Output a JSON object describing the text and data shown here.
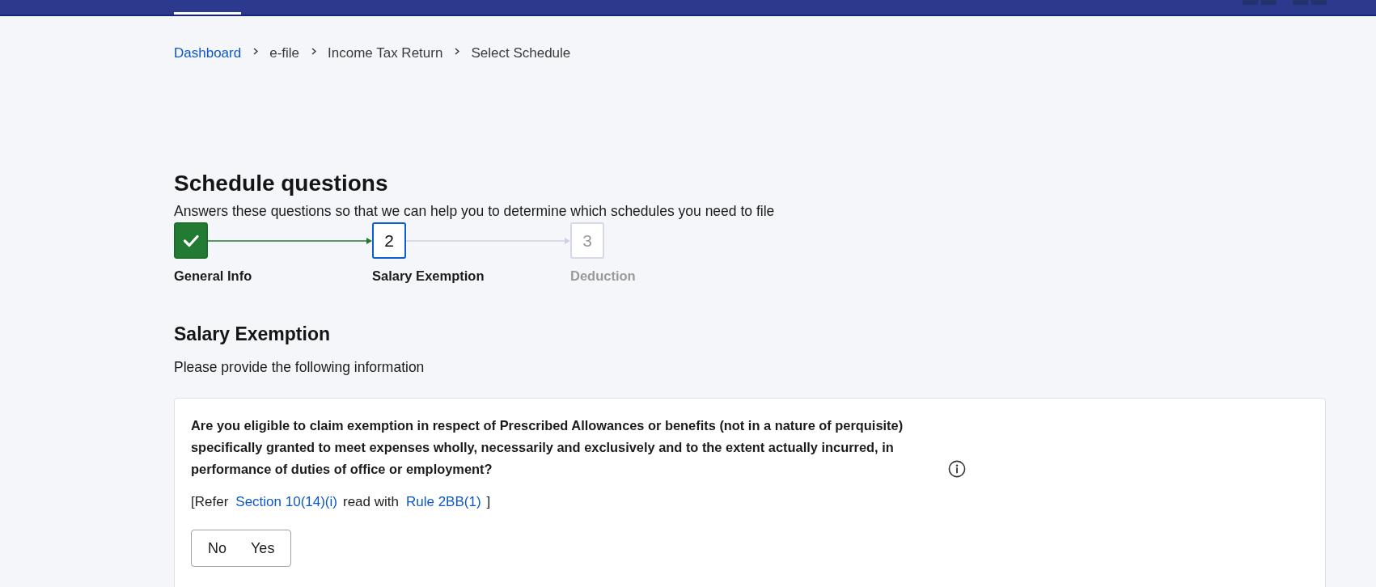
{
  "breadcrumb": [
    {
      "label": "Dashboard",
      "kind": "link"
    },
    {
      "label": "e-file",
      "kind": "text"
    },
    {
      "label": "Income Tax Return",
      "kind": "text"
    },
    {
      "label": "Select Schedule",
      "kind": "text"
    }
  ],
  "page": {
    "title": "Schedule questions",
    "subtitle": "Answers these questions so that we can help you to determine which schedules you need to file"
  },
  "steps": [
    {
      "label": "General Info",
      "completed": true,
      "selected": false
    },
    {
      "number": "2",
      "label": "Salary Exemption",
      "completed": false,
      "selected": true
    },
    {
      "number": "3",
      "label": "Deduction",
      "completed": false,
      "selected": false
    }
  ],
  "section": {
    "title": "Salary Exemption",
    "instruction": "Please provide the following information"
  },
  "questions": [
    {
      "text": "Are you eligible to claim exemption in respect of Prescribed Allowances or benefits (not in a nature of perquisite) specifically granted to meet expenses wholly, necessarily and exclusively and to the extent actually incurred, in performance of duties of office or employment?",
      "reference": [
        {
          "kind": "text",
          "text": "[Refer"
        },
        {
          "kind": "link",
          "text": "Section 10(14)(i)"
        },
        {
          "kind": "text",
          "text": "read with"
        },
        {
          "kind": "link",
          "text": "Rule 2BB(1)"
        },
        {
          "kind": "text",
          "text": "]"
        }
      ],
      "options": [
        {
          "label": "No",
          "selected": false
        },
        {
          "label": "Yes",
          "selected": false
        }
      ]
    }
  ]
}
